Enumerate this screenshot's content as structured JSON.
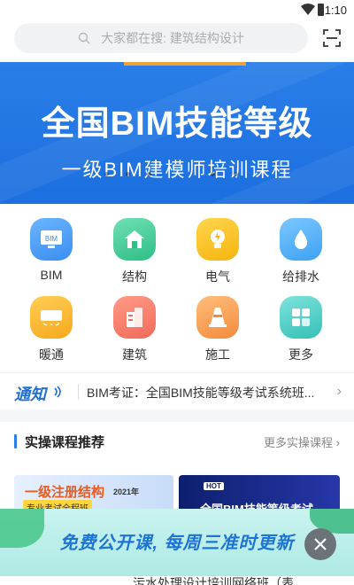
{
  "status_bar": {
    "time": "1:10"
  },
  "search": {
    "placeholder": "大家都在搜: 建筑结构设计"
  },
  "banner": {
    "title": "全国BIM技能等级",
    "subtitle": "一级BIM建模师培训课程"
  },
  "categories": [
    {
      "label": "BIM",
      "icon": "bim-icon",
      "color": "#3b8ef2"
    },
    {
      "label": "结构",
      "icon": "structure-house-icon",
      "color": "#2fbe86"
    },
    {
      "label": "电气",
      "icon": "electric-bulb-icon",
      "color": "#f5b50f"
    },
    {
      "label": "给排水",
      "icon": "water-drop-icon",
      "color": "#3da2f4"
    },
    {
      "label": "暖通",
      "icon": "hvac-unit-icon",
      "color": "#f7a81c"
    },
    {
      "label": "建筑",
      "icon": "building-icon",
      "color": "#f26a59"
    },
    {
      "label": "施工",
      "icon": "traffic-cone-icon",
      "color": "#f58a3d"
    },
    {
      "label": "更多",
      "icon": "more-grid-icon",
      "color": "#35c0b6"
    }
  ],
  "notice": {
    "logo": "通知",
    "message": "BIM考证：全国BIM技能等级考试系统班..."
  },
  "section": {
    "title": "实操课程推荐",
    "more": "更多实操课程"
  },
  "cards": [
    {
      "title": "一级注册结构",
      "year": "2021年",
      "tag": "专业考试全程班"
    },
    {
      "hot": "HOT",
      "title": "全国BIM技能等级考试"
    }
  ],
  "promo": {
    "text": "免费公开课, 每周三准时更新"
  },
  "peek": {
    "text": "污水处理设计培训网络班（表"
  },
  "colors": {
    "accent": "#2a7ee8",
    "promo_text": "#1e73d6"
  }
}
